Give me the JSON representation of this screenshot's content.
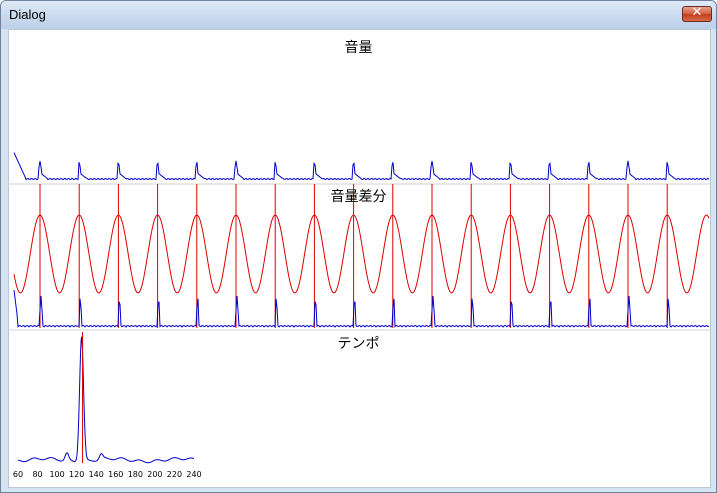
{
  "window": {
    "title": "Dialog",
    "close_glyph": "✕"
  },
  "panels": {
    "volume": {
      "title": "音量"
    },
    "diff": {
      "title": "音量差分"
    },
    "tempo": {
      "title": "テンポ"
    }
  },
  "colors": {
    "blue": "#0000cc",
    "red": "#dd0000",
    "divider": "#d0d0d0"
  },
  "chart_data": [
    {
      "type": "line",
      "title": "音量",
      "series": [
        {
          "values": "periodic spikes",
          "peaks": 17
        }
      ],
      "grid": false
    },
    {
      "type": "line",
      "title": "音量差分",
      "series": [
        {
          "color": "red",
          "kind": "sinusoid",
          "cycles": 17
        },
        {
          "color": "blue",
          "kind": "impulses",
          "count": 17
        }
      ],
      "grid": false
    },
    {
      "type": "line",
      "title": "テンポ",
      "x": [
        60,
        80,
        100,
        120,
        140,
        160,
        180,
        200,
        220,
        240
      ],
      "tick_labels": [
        "60",
        "80",
        "100",
        "120",
        "140",
        "160",
        "180",
        "200",
        "220",
        "240"
      ],
      "peak_x": 125,
      "xlim": [
        60,
        240
      ],
      "grid": false
    }
  ]
}
